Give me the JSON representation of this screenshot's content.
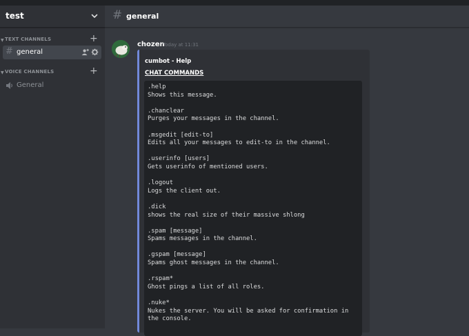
{
  "server": {
    "name": "test"
  },
  "categories": {
    "text": "TEXT CHANNELS",
    "voice": "VOICE CHANNELS"
  },
  "text_channels": [
    {
      "name": "general",
      "active": true
    }
  ],
  "voice_channels": [
    {
      "name": "General"
    }
  ],
  "header": {
    "channel": "general"
  },
  "message": {
    "author": "chozen",
    "timestamp": "Today at 11:31"
  },
  "embed": {
    "author": "cumbot - Help",
    "field_name": "CHAT COMMANDS",
    "accent_color": "#7289da",
    "commands": [
      {
        "cmd": ".help",
        "desc": "Shows this message."
      },
      {
        "cmd": ".chanclear",
        "desc": "Purges your messages in the channel."
      },
      {
        "cmd": ".msgedit [edit-to]",
        "desc": "Edits all your messages to edit-to in the channel."
      },
      {
        "cmd": ".userinfo [users]",
        "desc": "Gets userinfo of mentioned users."
      },
      {
        "cmd": ".logout",
        "desc": "Logs the client out."
      },
      {
        "cmd": ".dick",
        "desc": "shows the real size of their massive shlong"
      },
      {
        "cmd": ".spam [message]",
        "desc": "Spams messages in the channel."
      },
      {
        "cmd": ".gspam [message]",
        "desc": "Spams ghost messages in the channel."
      },
      {
        "cmd": ".rspam*",
        "desc": "Ghost pings a list of all roles."
      },
      {
        "cmd": ".nuke*",
        "desc": "Nukes the server. You will be asked for confirmation in the console."
      }
    ]
  },
  "icons": {
    "chevron": "chevron-down-icon",
    "add": "plus-icon",
    "text_channel": "hash-icon",
    "voice_channel": "speaker-icon",
    "invite": "add-member-icon",
    "settings": "gear-icon"
  },
  "colors": {
    "accent": "#7289da",
    "background": "#36393f",
    "sidebar": "#2f3136"
  }
}
